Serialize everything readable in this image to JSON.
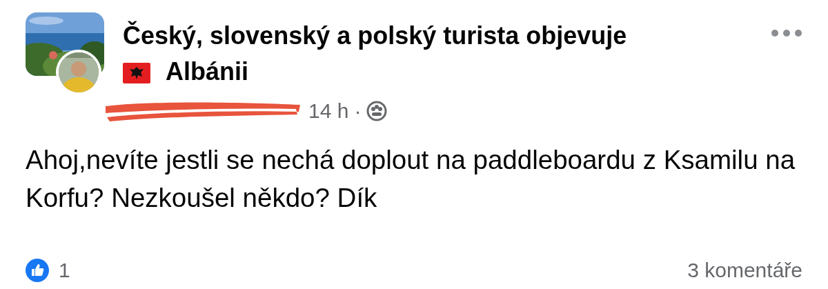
{
  "post": {
    "group_title": [
      "Český, slovenský a polský turista objevuje",
      "Albánii"
    ],
    "time": "14 h",
    "separator": "·",
    "body": "Ahoj,nevíte jestli se nechá doplout na paddleboardu z Ksamilu na Korfu? Nezkoušel někdo? Dík",
    "likes": "1",
    "comments": "3 komentáře"
  }
}
